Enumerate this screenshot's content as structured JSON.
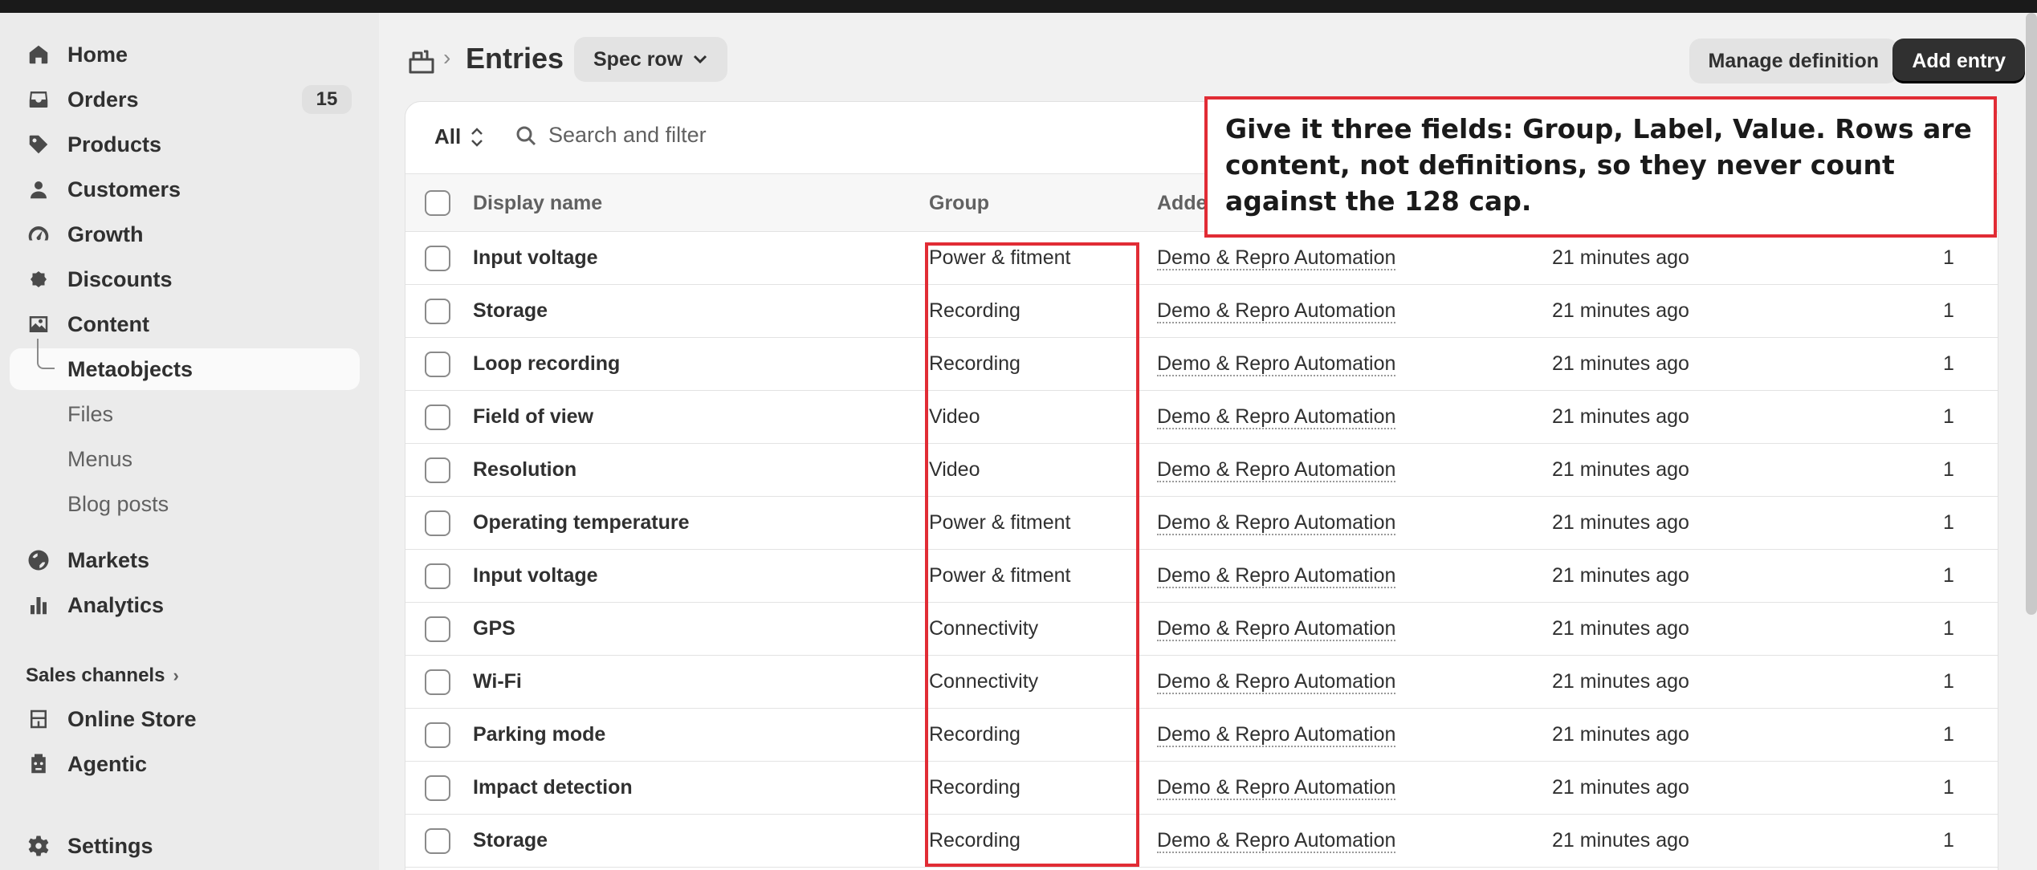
{
  "sidebar": {
    "items": [
      {
        "label": "Home",
        "icon": "home-icon"
      },
      {
        "label": "Orders",
        "icon": "inbox-icon",
        "badge": "15"
      },
      {
        "label": "Products",
        "icon": "tag-icon"
      },
      {
        "label": "Customers",
        "icon": "person-icon"
      },
      {
        "label": "Growth",
        "icon": "gauge-icon"
      },
      {
        "label": "Discounts",
        "icon": "discount-icon"
      },
      {
        "label": "Content",
        "icon": "image-icon"
      },
      {
        "label": "Metaobjects"
      },
      {
        "label": "Files"
      },
      {
        "label": "Menus"
      },
      {
        "label": "Blog posts"
      },
      {
        "label": "Markets",
        "icon": "globe-icon"
      },
      {
        "label": "Analytics",
        "icon": "bar-chart-icon"
      },
      {
        "label": "Online Store",
        "icon": "store-icon"
      },
      {
        "label": "Agentic",
        "icon": "robot-icon"
      },
      {
        "label": "Settings",
        "icon": "gear-icon"
      }
    ],
    "sales_channels_label": "Sales channels"
  },
  "header": {
    "title": "Entries",
    "definition_selector": "Spec row",
    "manage_label": "Manage definition",
    "add_label": "Add entry"
  },
  "filter": {
    "all_label": "All",
    "search_placeholder": "Search and filter"
  },
  "table": {
    "columns": [
      "Display name",
      "Group",
      "Adde"
    ],
    "rows": [
      {
        "name": "Input voltage",
        "group": "Power & fitment",
        "added": "Demo & Repro Automation",
        "time": "21 minutes ago",
        "count": "1"
      },
      {
        "name": "Storage",
        "group": "Recording",
        "added": "Demo & Repro Automation",
        "time": "21 minutes ago",
        "count": "1"
      },
      {
        "name": "Loop recording",
        "group": "Recording",
        "added": "Demo & Repro Automation",
        "time": "21 minutes ago",
        "count": "1"
      },
      {
        "name": "Field of view",
        "group": "Video",
        "added": "Demo & Repro Automation",
        "time": "21 minutes ago",
        "count": "1"
      },
      {
        "name": "Resolution",
        "group": "Video",
        "added": "Demo & Repro Automation",
        "time": "21 minutes ago",
        "count": "1"
      },
      {
        "name": "Operating temperature",
        "group": "Power & fitment",
        "added": "Demo & Repro Automation",
        "time": "21 minutes ago",
        "count": "1"
      },
      {
        "name": "Input voltage",
        "group": "Power & fitment",
        "added": "Demo & Repro Automation",
        "time": "21 minutes ago",
        "count": "1"
      },
      {
        "name": "GPS",
        "group": "Connectivity",
        "added": "Demo & Repro Automation",
        "time": "21 minutes ago",
        "count": "1"
      },
      {
        "name": "Wi-Fi",
        "group": "Connectivity",
        "added": "Demo & Repro Automation",
        "time": "21 minutes ago",
        "count": "1"
      },
      {
        "name": "Parking mode",
        "group": "Recording",
        "added": "Demo & Repro Automation",
        "time": "21 minutes ago",
        "count": "1"
      },
      {
        "name": "Impact detection",
        "group": "Recording",
        "added": "Demo & Repro Automation",
        "time": "21 minutes ago",
        "count": "1"
      },
      {
        "name": "Storage",
        "group": "Recording",
        "added": "Demo & Repro Automation",
        "time": "21 minutes ago",
        "count": "1"
      }
    ]
  },
  "annotation": {
    "text": "Give it three fields: Group, Label, Value. Rows are content, not definitions, so they never count against the 128 cap."
  },
  "colors": {
    "highlight": "#e12c35",
    "primary_button": "#303030"
  }
}
